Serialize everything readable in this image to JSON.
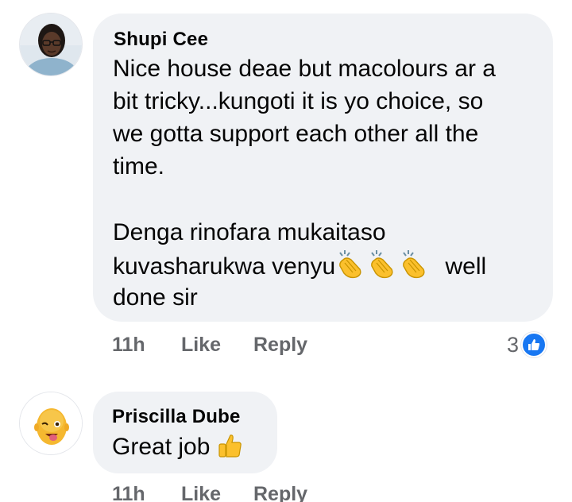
{
  "comments": [
    {
      "author": "Shupi Cee",
      "lines": [
        "Nice house deae but macolours ar a",
        "bit tricky...kungoti it is yo choice, so",
        "we gotta support each other all the",
        "time.",
        "",
        "Denga rinofara mukaitaso",
        "kuvasharukwa venyu",
        "well",
        "done sir"
      ],
      "emoji": [
        "clapping-hands",
        "clapping-hands",
        "clapping-hands"
      ],
      "time": "11h",
      "like_label": "Like",
      "reply_label": "Reply",
      "reaction_count": "3",
      "reaction_type": "like"
    },
    {
      "author": "Priscilla Dube",
      "text": "Great job",
      "emoji": [
        "thumbs-up"
      ],
      "time": "11h",
      "like_label": "Like",
      "reply_label": "Reply"
    }
  ],
  "colors": {
    "bubble": "#f0f2f5",
    "meta_text": "#65676b",
    "like_blue": "#1877f2",
    "emoji_yellow": "#fbc02d"
  }
}
